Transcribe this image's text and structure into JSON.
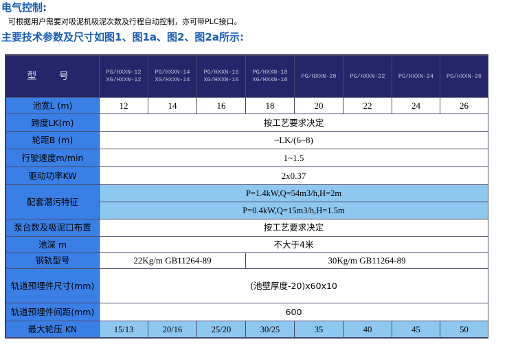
{
  "heading_electric": "电气控制:",
  "description": "可根据用户需要对吸泥机吸泥次数及行程自动控制，亦可带PLC接口。",
  "heading_params": "主要技术参数及尺寸如图1、图1a、图2、图2a所示:",
  "table": {
    "header_label": "型 号",
    "models": [
      {
        "l1": "PG/HXXN-12",
        "l2": "XG/HXXN-12"
      },
      {
        "l1": "PG/HXXN-14",
        "l2": "XG/HXXN-14"
      },
      {
        "l1": "PG/HXXN-16",
        "l2": "XG/HXXN-16"
      },
      {
        "l1": "PG/HXXN-18",
        "l2": "XG/HXXN-18"
      },
      {
        "l1": "PG/HXXN-20",
        "l2": ""
      },
      {
        "l1": "PG/HXXN-22",
        "l2": ""
      },
      {
        "l1": "PG/HXXN-24",
        "l2": ""
      },
      {
        "l1": "PG/HXXN-26",
        "l2": ""
      }
    ],
    "pool_width": {
      "label": "池宽L (m)",
      "values": [
        "12",
        "14",
        "16",
        "18",
        "20",
        "22",
        "24",
        "26"
      ]
    },
    "span": {
      "label": "跨度LK(m)",
      "value": "按工艺要求决定"
    },
    "wheelbase": {
      "label": "轮距B (m)",
      "value": "~LK/(6~8)"
    },
    "travel_speed": {
      "label": "行驶速度m/min",
      "value": "1~1.5"
    },
    "drive_power": {
      "label": "驱动功率KW",
      "value": "2x0.37"
    },
    "pump": {
      "label": "配套潜污特征",
      "value1": "P=1.4kW,Q=54m3/h,H=2m",
      "value2": "P=0.4kW,Q=15m3/h,H=1.5m"
    },
    "pump_count": {
      "label": "泵台数及吸泥口布置",
      "value": "按工艺要求决定"
    },
    "pool_depth": {
      "label": "池深 m",
      "value": "不大于4米"
    },
    "rail": {
      "label": "钢轨型号",
      "value1": "22Kg/m GB11264-89",
      "value2": "30Kg/m GB11264-89"
    },
    "embed_size": {
      "label": "轨道预埋件尺寸(mm)",
      "value": "(池壁厚度-20)x60x10"
    },
    "embed_spacing": {
      "label": "轨道预埋件间距(mm)",
      "value": "600"
    },
    "max_wheel": {
      "label": "最大轮压 KN",
      "values": [
        "15/13",
        "20/16",
        "25/20",
        "30/25",
        "35",
        "40",
        "45",
        "50"
      ]
    }
  }
}
